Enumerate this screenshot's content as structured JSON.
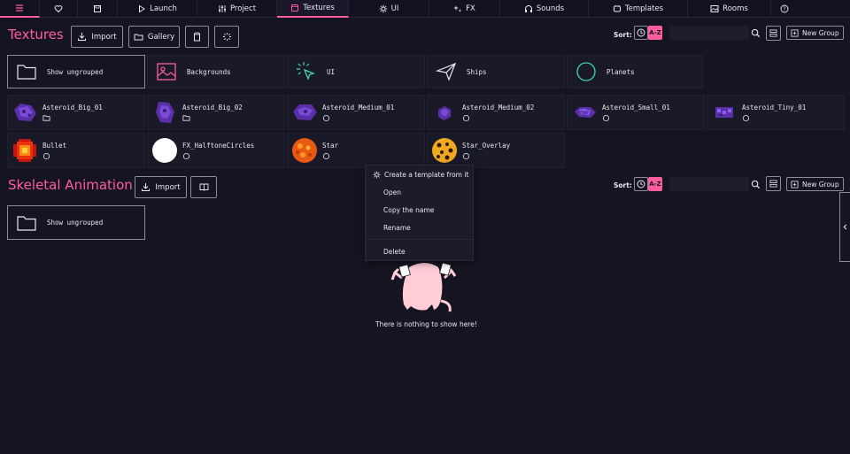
{
  "nav": {
    "items": [
      {
        "label": "",
        "icon": "heart-icon"
      },
      {
        "label": "",
        "icon": "save-icon"
      },
      {
        "label": "Launch",
        "icon": "play-icon"
      },
      {
        "label": "Project",
        "icon": "sliders-icon"
      },
      {
        "label": "Textures",
        "icon": "texture-icon"
      },
      {
        "label": "UI",
        "icon": "ui-icon"
      },
      {
        "label": "FX",
        "icon": "sparkles-icon"
      },
      {
        "label": "Sounds",
        "icon": "headphones-icon"
      },
      {
        "label": "Templates",
        "icon": "templates-icon"
      },
      {
        "label": "Rooms",
        "icon": "image-icon"
      }
    ],
    "active": "Textures"
  },
  "textures": {
    "title": "Textures",
    "import_label": "Import",
    "gallery_label": "Gallery",
    "sort_label": "Sort:",
    "sort_az": "A-Z",
    "search_value": "",
    "new_group_label": "New Group",
    "folders": [
      {
        "label": "Show ungrouped",
        "icon": "folder-icon"
      },
      {
        "label": "Backgrounds",
        "icon": "image-icon",
        "color": "#ff5d9e"
      },
      {
        "label": "UI",
        "icon": "cursor-icon",
        "color": "#3fd9b0"
      },
      {
        "label": "Ships",
        "icon": "send-icon",
        "color": "#e8e6f0"
      },
      {
        "label": "Planets",
        "icon": "circle-icon",
        "color": "#3fd9b0"
      }
    ],
    "assets": [
      {
        "name": "Asteroid_Big_01",
        "sub_icon": "folder-small-icon",
        "thumb": "asteroid"
      },
      {
        "name": "Asteroid_Big_02",
        "sub_icon": "folder-small-icon",
        "thumb": "asteroid"
      },
      {
        "name": "Asteroid_Medium_01",
        "sub_icon": "circle-small-icon",
        "thumb": "asteroid"
      },
      {
        "name": "Asteroid_Medium_02",
        "sub_icon": "circle-small-icon",
        "thumb": "asteroid"
      },
      {
        "name": "Asteroid_Small_01",
        "sub_icon": "circle-small-icon",
        "thumb": "asteroid"
      },
      {
        "name": "Asteroid_Tiny_01",
        "sub_icon": "circle-small-icon",
        "thumb": "asteroid"
      },
      {
        "name": "Bullet",
        "sub_icon": "circle-small-icon",
        "thumb": "bullet"
      },
      {
        "name": "FX_HalftoneCircles",
        "sub_icon": "circle-small-icon",
        "thumb": "white"
      },
      {
        "name": "Star",
        "sub_icon": "circle-small-icon",
        "thumb": "star"
      },
      {
        "name": "Star_Overlay",
        "sub_icon": "circle-small-icon",
        "thumb": "star-overlay"
      }
    ]
  },
  "skeletal": {
    "title": "Skeletal Animation",
    "import_label": "Import",
    "sort_label": "Sort:",
    "sort_az": "A-Z",
    "new_group_label": "New Group",
    "folder_label": "Show ungrouped",
    "empty_text": "There is nothing to show here!"
  },
  "context_menu": {
    "items": [
      "Create a template from it",
      "Open",
      "Copy the name",
      "Rename",
      "Delete"
    ]
  },
  "colors": {
    "accent": "#ff5d9e",
    "teal": "#3fd9b0",
    "background": "#151421"
  }
}
